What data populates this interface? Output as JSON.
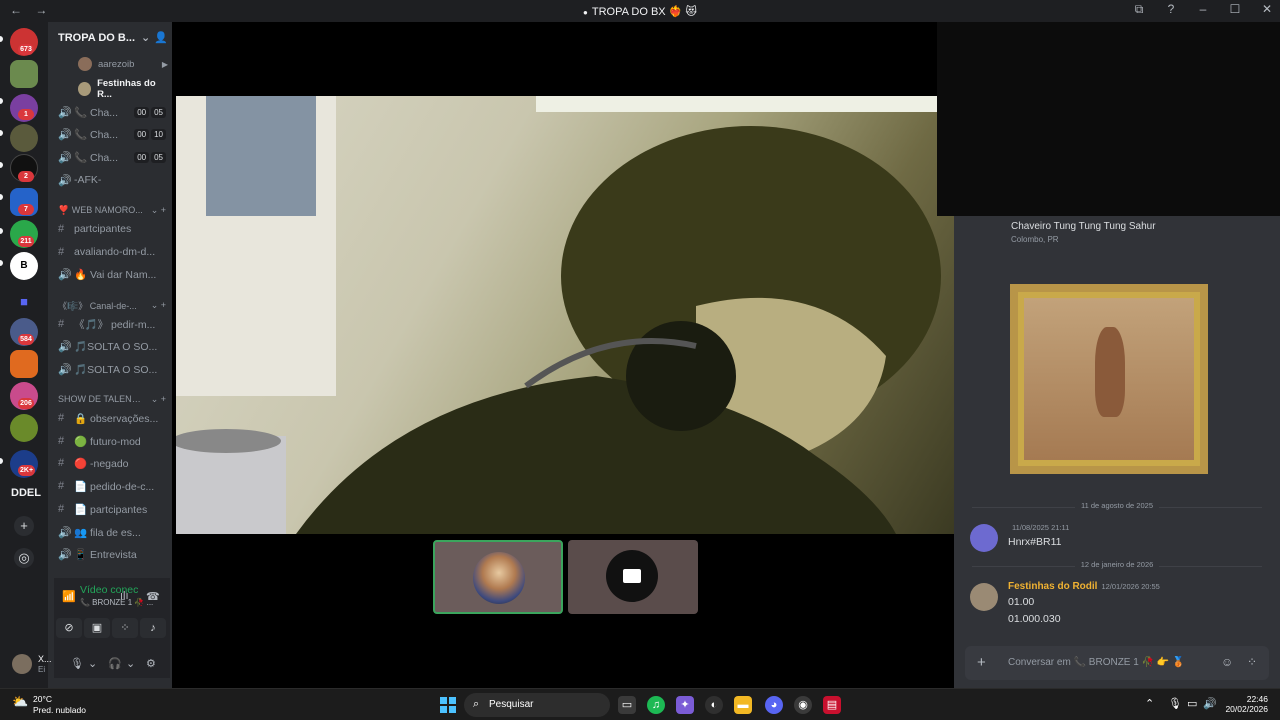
{
  "window": {
    "title": "TROPA DO BX ❤️‍🔥 😻",
    "back": "←",
    "forward": "→"
  },
  "server_rail": {
    "badges": [
      "673",
      "1",
      "2",
      "7",
      "211",
      "584",
      "206",
      "2K+"
    ],
    "server_label": "DDEL"
  },
  "sidebar": {
    "server_name": "TROPA DO B...",
    "voice_users": [
      "aarezoib",
      "Festinhas do R..."
    ],
    "channels_top": [
      {
        "icon": "🔊",
        "label": "📞 Cha...",
        "time": [
          "00",
          "05"
        ]
      },
      {
        "icon": "🔊",
        "label": "📞 Cha...",
        "time": [
          "00",
          "10"
        ]
      },
      {
        "icon": "🔊",
        "label": "📞 Cha...",
        "time": [
          "00",
          "05"
        ]
      },
      {
        "icon": "🔊",
        "label": "-AFK-"
      }
    ],
    "categories": [
      {
        "name": "❣️ WEB NAMORO...",
        "channels": [
          {
            "icon": "#",
            "label": "partcipantes"
          },
          {
            "icon": "#",
            "label": "avaliando-dm-d..."
          },
          {
            "icon": "🔊",
            "label": "🔥 Vai dar Nam..."
          }
        ]
      },
      {
        "name": "《🎼》 Canal-de-...",
        "channels": [
          {
            "icon": "#",
            "label": "《🎵》 pedir-m..."
          },
          {
            "icon": "🔊",
            "label": "🎵SOLTA O SO..."
          },
          {
            "icon": "🔊",
            "label": "🎵SOLTA O SO..."
          }
        ]
      },
      {
        "name": "SHOW DE TALENTE...",
        "channels": [
          {
            "icon": "#",
            "label": "🔒 observações..."
          },
          {
            "icon": "#",
            "label": "🟢 futuro-mod"
          },
          {
            "icon": "#",
            "label": "🔴 -negado"
          },
          {
            "icon": "#",
            "label": "📄 pedido-de-c..."
          },
          {
            "icon": "#",
            "label": "📄 partcipantes"
          },
          {
            "icon": "🔊",
            "label": "👥 fila de es..."
          },
          {
            "icon": "🔊",
            "label": "📱 Entrevista"
          }
        ]
      }
    ]
  },
  "voice_panel": {
    "status": "Vídeo conectad",
    "channel": "📞 BRONZE 1 🥀 ..."
  },
  "user_bar": {
    "name": "X...",
    "status": "Ei"
  },
  "chat": {
    "profile_name": "Chaveiro Tung Tung Tung Sahur",
    "profile_location": "Colombo, PR",
    "dividers": [
      "11 de agosto de 2025",
      "12 de janeiro de 2026"
    ],
    "messages": [
      {
        "author": "",
        "timestamp": "11/08/2025 21:11",
        "lines": [
          "Hnrx#BR11"
        ],
        "author_color": "#9b59b6"
      },
      {
        "author": "Festinhas do Rodil",
        "timestamp": "12/01/2026 20:55",
        "lines": [
          "01.00",
          "01.000.030"
        ],
        "author_color": "#f0b232"
      }
    ],
    "composer_placeholder": "Conversar em 📞 BRONZE 1 🥀 👉 🥉"
  },
  "taskbar": {
    "temperature": "20°C",
    "condition": "Pred. nublado",
    "search": "Pesquisar",
    "time": "22:46",
    "date": "20/02/2026"
  }
}
